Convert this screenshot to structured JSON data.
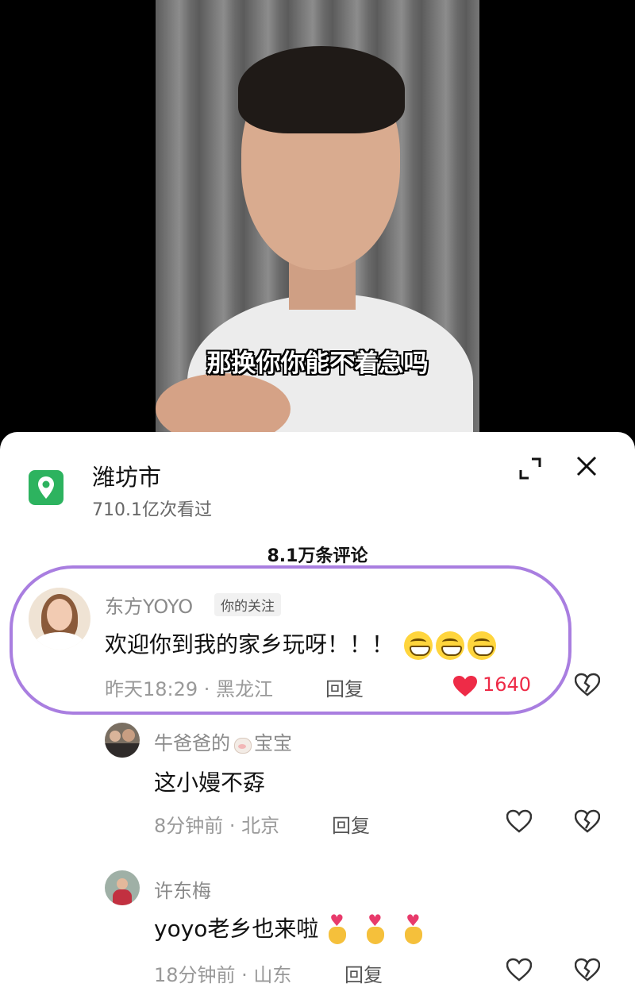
{
  "video": {
    "subtitle": "那换你你能不着急吗"
  },
  "panel": {
    "location_name": "潍坊市",
    "location_views": "710.1亿次看过",
    "comment_count": "8.1万条评论",
    "icons": {
      "location": "location-pin-icon",
      "expand": "expand-icon",
      "close": "close-icon"
    }
  },
  "comments": [
    {
      "username": "东方YOYO",
      "badge": "你的关注",
      "text": "欢迎你到我的家乡玩呀！！！",
      "emojis": [
        "grinning-face",
        "grinning-face",
        "grinning-face"
      ],
      "time_location": "昨天18:29 · 黑龙江",
      "reply_label": "回复",
      "likes": "1640",
      "liked": true
    },
    {
      "username_part1": "牛爸爸的",
      "username_part2": "宝宝",
      "text": "这小嫚不孬",
      "time_location": "8分钟前 · 北京",
      "reply_label": "回复"
    },
    {
      "username": "许东梅",
      "text": "yoyo老乡也来啦",
      "time_location": "18分钟前 · 山东",
      "reply_label": "回复"
    }
  ],
  "colors": {
    "accent_green": "#2db35f",
    "like_red": "#ee2b47",
    "highlight_purple": "#a97ee0"
  }
}
